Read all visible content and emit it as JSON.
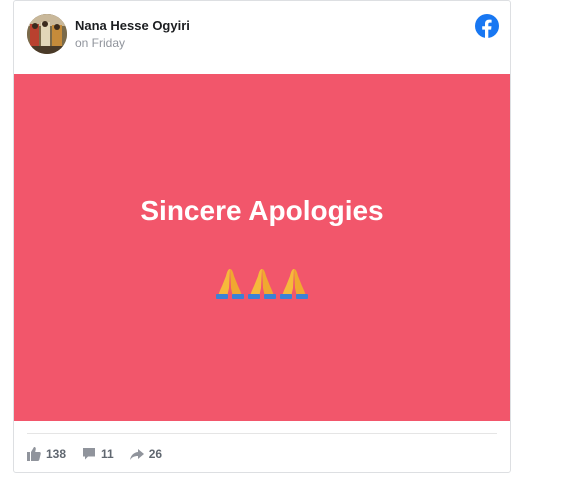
{
  "post": {
    "author_name": "Nana Hesse Ogyiri",
    "timestamp": "on Friday",
    "banner_text": "Sincere Apologies",
    "banner_emoji": [
      "🙏",
      "🙏",
      "🙏"
    ],
    "banner_color": "#f2566b",
    "brand_color": "#1877f2"
  },
  "stats": {
    "likes": "138",
    "comments": "11",
    "shares": "26"
  },
  "icons": {
    "like": "thumbs-up-icon",
    "comment": "comment-bubble-icon",
    "share": "share-arrow-icon",
    "brand": "facebook-logo-icon"
  }
}
